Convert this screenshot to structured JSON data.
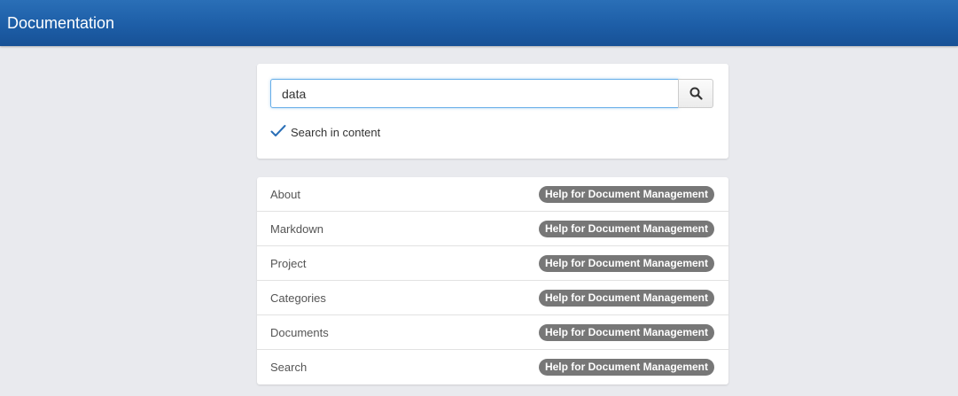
{
  "header": {
    "title": "Documentation"
  },
  "search": {
    "value": "data",
    "button_icon": "search-icon",
    "option_label": "Search in content",
    "option_checked": true
  },
  "results": [
    {
      "name": "About",
      "badge": "Help for Document Management"
    },
    {
      "name": "Markdown",
      "badge": "Help for Document Management"
    },
    {
      "name": "Project",
      "badge": "Help for Document Management"
    },
    {
      "name": "Categories",
      "badge": "Help for Document Management"
    },
    {
      "name": "Documents",
      "badge": "Help for Document Management"
    },
    {
      "name": "Search",
      "badge": "Help for Document Management"
    }
  ],
  "colors": {
    "header": "#1d5ea7",
    "badge": "#777777",
    "check": "#2a6fb7"
  }
}
